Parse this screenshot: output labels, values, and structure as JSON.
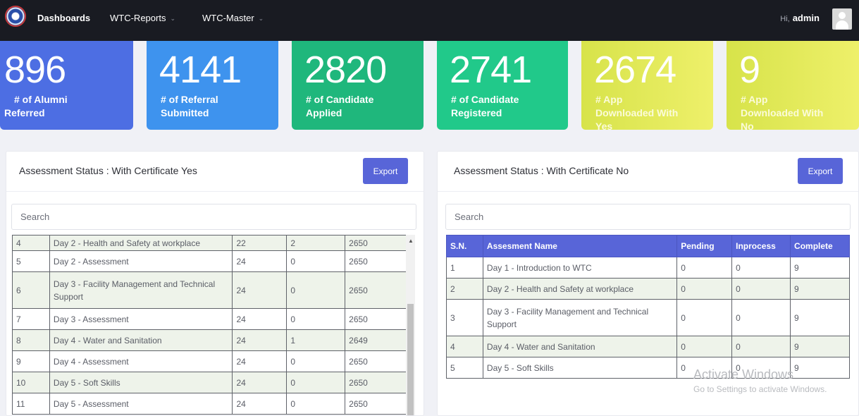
{
  "nav": {
    "brand": "Dashboards",
    "items": [
      {
        "label": "WTC-Reports"
      },
      {
        "label": "WTC-Master"
      }
    ],
    "greeting": "Hi,",
    "user": "admin"
  },
  "cards": [
    {
      "value": "896",
      "label_line1": "# of Alumni",
      "label_line2": "Referred",
      "label_line3": "",
      "color": "#4d6ee3"
    },
    {
      "value": "4141",
      "label_line1": "# of Referral",
      "label_line2": "Submitted",
      "label_line3": "",
      "color": "#3e93ee"
    },
    {
      "value": "2820",
      "label_line1": "# of Candidate",
      "label_line2": "Applied",
      "label_line3": "",
      "color": "#1fb77c"
    },
    {
      "value": "2741",
      "label_line1": "# of Candidate",
      "label_line2": "Registered",
      "label_line3": "",
      "color": "#21c98a"
    },
    {
      "value": "2674",
      "label_line1": "# App",
      "label_line2": "Downloaded With",
      "label_line3": "Yes",
      "color": "#e2ea58"
    },
    {
      "value": "9",
      "label_line1": "# App",
      "label_line2": "Downloaded With",
      "label_line3": "No",
      "color": "#e2ea58"
    }
  ],
  "left_panel": {
    "title": "Assessment Status : With Certificate Yes",
    "export_label": "Export",
    "search_placeholder": "Search",
    "rows": [
      [
        "4",
        "Day 2 - Health and Safety at workplace",
        "22",
        "2",
        "2650"
      ],
      [
        "5",
        "Day 2 - Assessment",
        "24",
        "0",
        "2650"
      ],
      [
        "6",
        "Day 3 - Facility Management and Technical Support",
        "24",
        "0",
        "2650"
      ],
      [
        "7",
        "Day 3 - Assessment",
        "24",
        "0",
        "2650"
      ],
      [
        "8",
        "Day 4 - Water and Sanitation",
        "24",
        "1",
        "2649"
      ],
      [
        "9",
        "Day 4 - Assessment",
        "24",
        "0",
        "2650"
      ],
      [
        "10",
        "Day 5 - Soft Skills",
        "24",
        "0",
        "2650"
      ],
      [
        "11",
        "Day 5 - Assessment",
        "24",
        "0",
        "2650"
      ]
    ]
  },
  "right_panel": {
    "title": "Assessment Status : With Certificate No",
    "export_label": "Export",
    "search_placeholder": "Search",
    "columns": [
      "S.N.",
      "Assesment Name",
      "Pending",
      "Inprocess",
      "Complete"
    ],
    "rows": [
      [
        "1",
        "Day 1 - Introduction to WTC",
        "0",
        "0",
        "9"
      ],
      [
        "2",
        "Day 2 - Health and Safety at workplace",
        "0",
        "0",
        "9"
      ],
      [
        "3",
        "Day 3 - Facility Management and Technical Support",
        "0",
        "0",
        "9"
      ],
      [
        "4",
        "Day 4 - Water and Sanitation",
        "0",
        "0",
        "9"
      ],
      [
        "5",
        "Day 5 - Soft Skills",
        "0",
        "0",
        "9"
      ]
    ]
  },
  "watermark": {
    "line1": "Activate Windows",
    "line2": "Go to Settings to activate Windows."
  }
}
